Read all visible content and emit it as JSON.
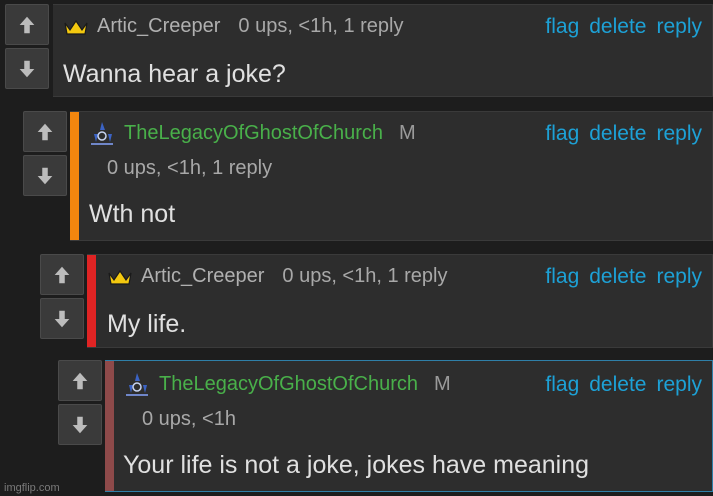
{
  "actions": {
    "flag": "flag",
    "delete": "delete",
    "reply": "reply"
  },
  "comments": [
    {
      "username": "Artic_Creeper",
      "meta": "0 ups, <1h, 1 reply",
      "text": "Wanna hear a joke?"
    },
    {
      "username": "TheLegacyOfGhostOfChurch",
      "badge": "M",
      "meta": "0 ups, <1h, 1 reply",
      "text": "Wth not"
    },
    {
      "username": "Artic_Creeper",
      "meta": "0 ups, <1h, 1 reply",
      "text": "My life."
    },
    {
      "username": "TheLegacyOfGhostOfChurch",
      "badge": "M",
      "meta": "0 ups, <1h",
      "text": "Your life is not a joke, jokes have meaning"
    }
  ],
  "watermark": "imgflip.com",
  "colors": {
    "accent_orange": "#f2860e",
    "accent_red": "#e02424",
    "accent_muted": "#8e4a4a",
    "link": "#1da1d6",
    "green_user": "#49b04a"
  },
  "icons": {
    "up": "arrow-up-icon",
    "down": "arrow-down-icon",
    "crown": "crown-icon",
    "ghost": "ghost-icon"
  }
}
